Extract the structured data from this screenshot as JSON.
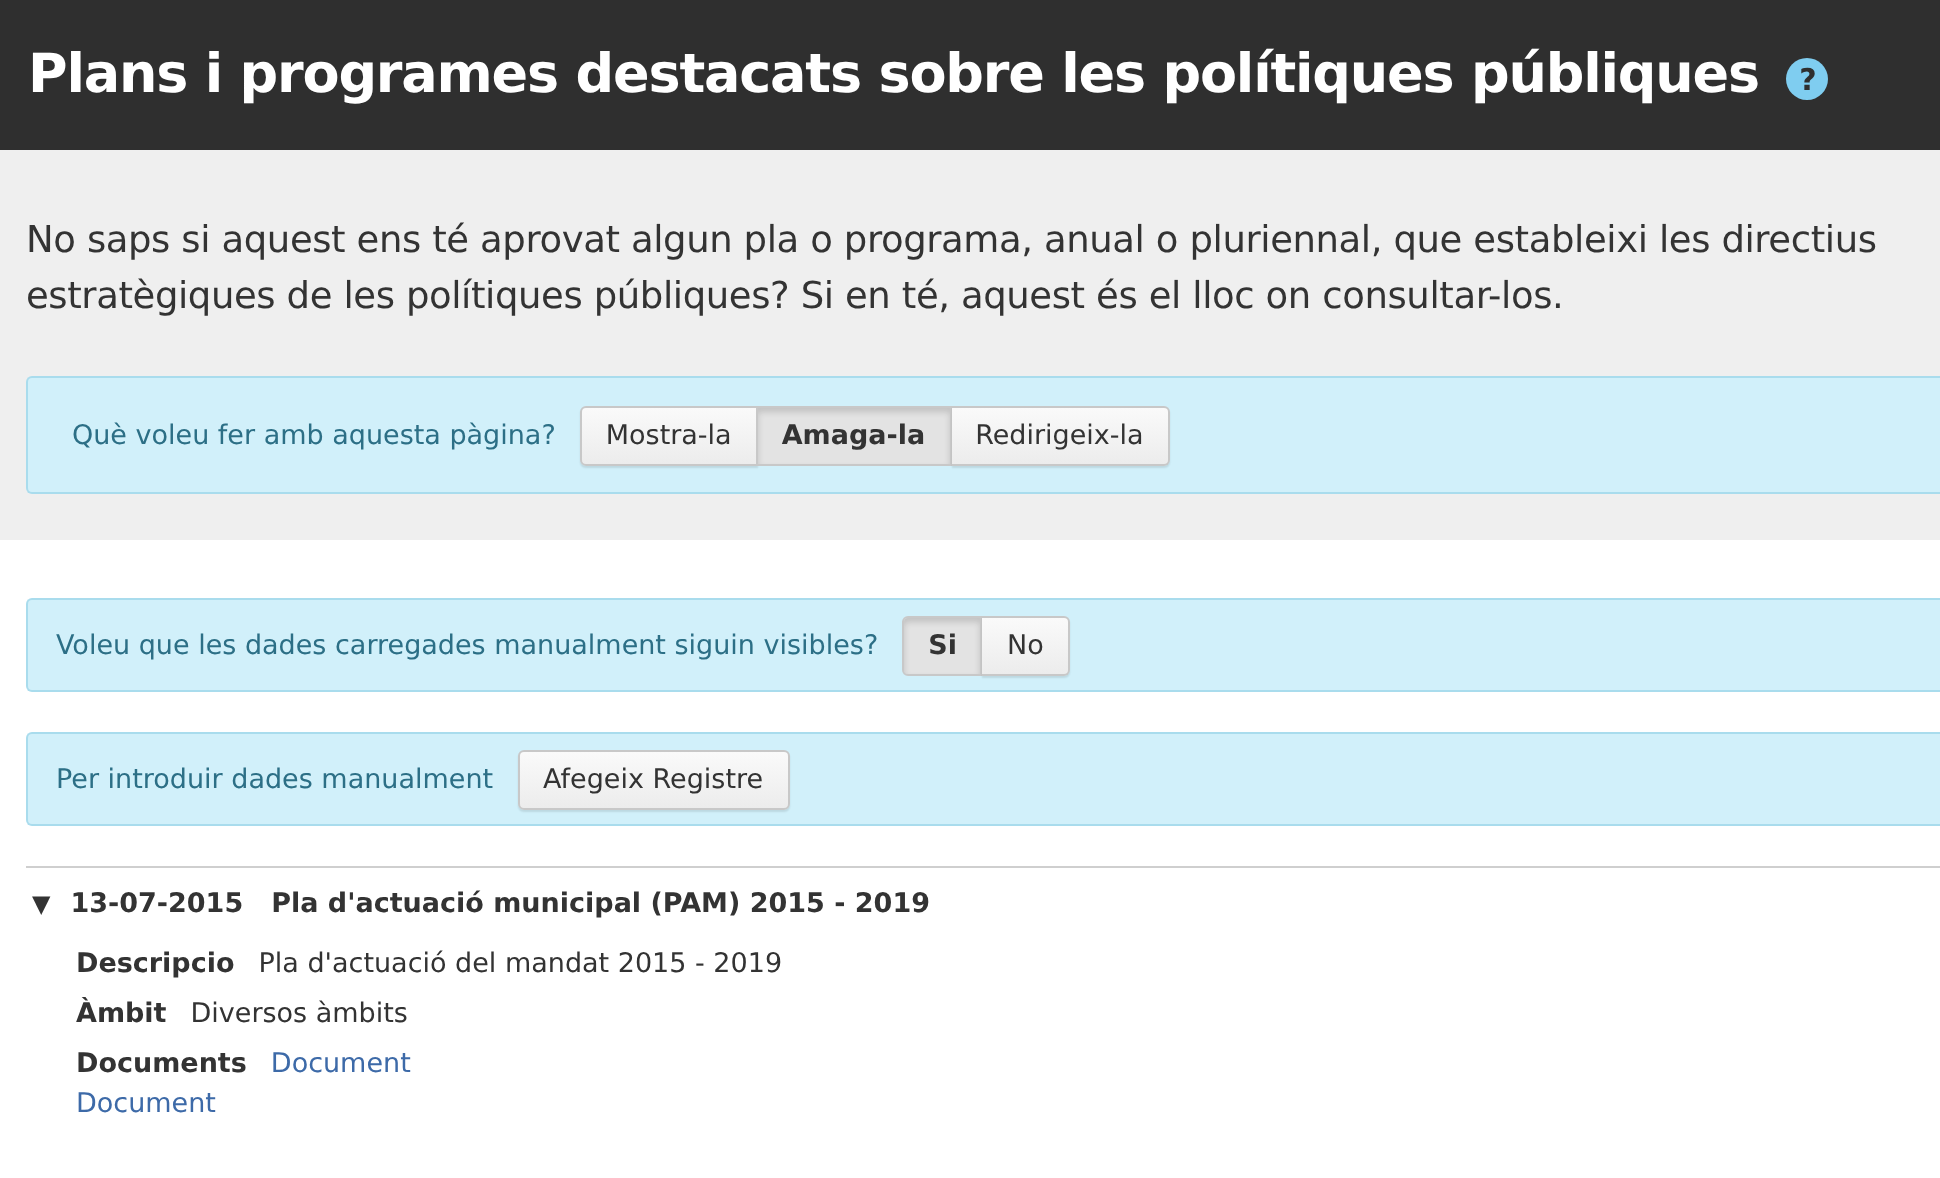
{
  "header": {
    "title": "Plans i programes destacats sobre les polítiques públiques",
    "help": "?"
  },
  "intro": "No saps si aquest ens té aprovat algun pla o programa, anual o pluriennal, que estableixi les directius estratègiques de les polítiques públiques? Si en té, aquest és el lloc on consultar-los.",
  "page_action": {
    "label": "Què voleu fer amb aquesta pàgina?",
    "options": [
      {
        "label": "Mostra-la",
        "selected": false
      },
      {
        "label": "Amaga-la",
        "selected": true
      },
      {
        "label": "Redirigeix-la",
        "selected": false
      }
    ]
  },
  "visibility": {
    "label": "Voleu que les dades carregades manualment siguin visibles?",
    "options": [
      {
        "label": "Si",
        "selected": true
      },
      {
        "label": "No",
        "selected": false
      }
    ]
  },
  "manual": {
    "label": "Per introduir dades manualment",
    "button": "Afegeix Registre"
  },
  "records": [
    {
      "toggle": "▼",
      "expanded": true,
      "date": "13-07-2015",
      "title": "Pla d'actuació municipal (PAM) 2015 - 2019",
      "fields": [
        {
          "kind": "text",
          "label": "Descripcio",
          "value": "Pla d'actuació del mandat 2015 - 2019"
        },
        {
          "kind": "text",
          "label": "Àmbit",
          "value": "Diversos àmbits"
        },
        {
          "kind": "links",
          "label": "Documents",
          "links": [
            "Document",
            "Document"
          ]
        }
      ]
    }
  ]
}
